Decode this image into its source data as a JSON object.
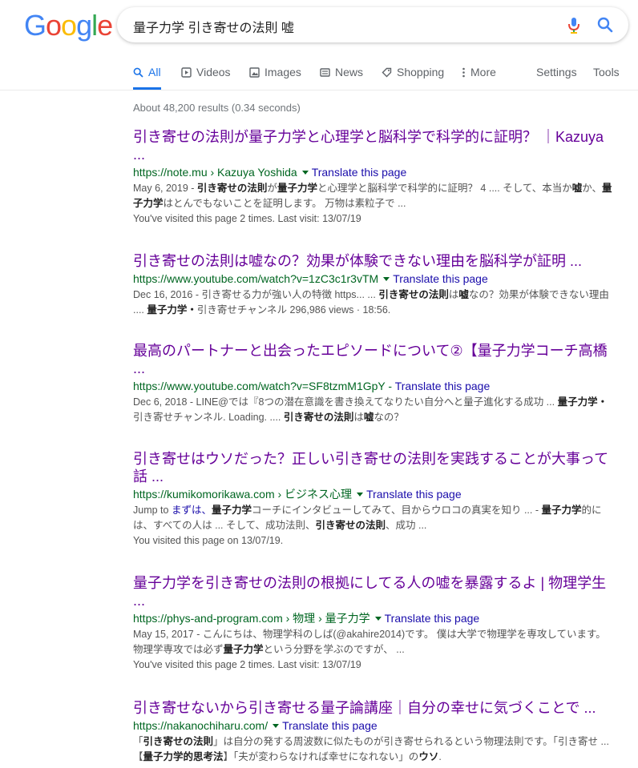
{
  "logo": {
    "letters": [
      "G",
      "o",
      "o",
      "g",
      "l",
      "e"
    ],
    "colors": [
      "#4285F4",
      "#EA4335",
      "#FBBC05",
      "#4285F4",
      "#34A853",
      "#EA4335"
    ]
  },
  "search": {
    "query": "量子力学 引き寄せの法則 嘘"
  },
  "tabs": [
    {
      "label": "All",
      "icon": "search-icon"
    },
    {
      "label": "Videos",
      "icon": "video-icon"
    },
    {
      "label": "Images",
      "icon": "image-icon"
    },
    {
      "label": "News",
      "icon": "news-icon"
    },
    {
      "label": "Shopping",
      "icon": "tag-icon"
    },
    {
      "label": "More",
      "icon": "more-vert-icon"
    },
    {
      "label": "Settings"
    },
    {
      "label": "Tools"
    }
  ],
  "stats": "About 48,200 results (0.34 seconds)",
  "results": [
    {
      "title": "引き寄せの法則が量子力学と心理学と脳科学で科学的に証明？ ｜Kazuya ...",
      "url": "https://note.mu › Kazuya Yoshida",
      "translate": "Translate this page",
      "snippet": [
        {
          "t": "May 6, 2019 - "
        },
        {
          "t": "引き寄せの法則",
          "b": true
        },
        {
          "t": "が"
        },
        {
          "t": "量子力学",
          "b": true
        },
        {
          "t": "と心理学と脳科学で科学的に証明？ 4 .... そして、本当か"
        },
        {
          "t": "嘘",
          "b": true
        },
        {
          "t": "か、"
        },
        {
          "t": "量子力学",
          "b": true
        },
        {
          "t": "はとんでもないことを証明します。 万物は素粒子で ..."
        }
      ],
      "visit": "You've visited this page 2 times. Last visit: 13/07/19"
    },
    {
      "title": "引き寄せの法則は嘘なの？効果が体験できない理由を脳科学が証明 ...",
      "url": "https://www.youtube.com/watch?v=1zC3c1r3vTM",
      "translate": "Translate this page",
      "snippet": [
        {
          "t": "Dec 16, 2016 - 引き寄せる力が強い人の特徴 https... ... "
        },
        {
          "t": "引き寄せの法則",
          "b": true
        },
        {
          "t": "は"
        },
        {
          "t": "嘘",
          "b": true
        },
        {
          "t": "なの？効果が体験できない"
        },
        {
          "t": "理由 .... "
        },
        {
          "t": "量子力学・",
          "b": true
        },
        {
          "t": "引き寄せチャンネル 296,986 views · 18:56."
        }
      ],
      "visit": ""
    },
    {
      "title": "最高のパートナーと出会ったエピソードについて②【量子力学コーチ高橋 ...",
      "url": "https://www.youtube.com/watch?v=SF8tzmM1GpY",
      "translate": "Translate this page",
      "snippet": [
        {
          "t": "Dec 6, 2018 - LINE@では『8つの潜在意識を書き換えてなりたい自分へと量子進化する成功 ... "
        },
        {
          "t": "量子力",
          "b": true
        },
        {
          "t": "学・",
          "b": true
        },
        {
          "t": "引き寄せチャンネル. Loading. .... "
        },
        {
          "t": "引き寄せの法則",
          "b": true
        },
        {
          "t": "は"
        },
        {
          "t": "嘘",
          "b": true
        },
        {
          "t": "なの？"
        }
      ],
      "visit": ""
    },
    {
      "title": "引き寄せはウソだった？正しい引き寄せの法則を実践することが大事って話 ...",
      "url": "https://kumikomorikawa.com › ビジネス心理",
      "translate": "Translate this page",
      "snippet": [
        {
          "t": "Jump to "
        },
        {
          "t": "まずは、"
        },
        {
          "t": "量子力学",
          "b": true
        },
        {
          "t": "コーチにインタビューしてみて、目からウロコの真実を知り ... - "
        },
        {
          "t": "量子力学",
          "b": true
        },
        {
          "t": "的"
        },
        {
          "t": "には、すべての人は ... そして、成功法則、"
        },
        {
          "t": "引き寄せの法則",
          "b": true
        },
        {
          "t": "、成功 ..."
        }
      ],
      "visit": "You visited this page on 13/07/19."
    },
    {
      "title": "量子力学を引き寄せの法則の根拠にしてる人の嘘を暴露するよ | 物理学生 ...",
      "url": "https://phys-and-program.com › 物理 › 量子力学",
      "translate": "Translate this page",
      "snippet": [
        {
          "t": "May 15, 2017 - こんにちは、物理学科のしば(@akahire2014)です。 僕は大学で物理学を専攻していま"
        },
        {
          "t": "す。 物理学専攻では必ず"
        },
        {
          "t": "量子力学",
          "b": true
        },
        {
          "t": "という分野を学ぶのですが、 ..."
        }
      ],
      "visit": "You've visited this page 2 times. Last visit: 13/07/19"
    },
    {
      "title": "引き寄せないから引き寄せる量子論講座｜自分の幸せに気づくことで ...",
      "url": "https://nakanochiharu.com/",
      "translate": "Translate this page",
      "snippet": [
        {
          "t": "「"
        },
        {
          "t": "引き寄せの法則",
          "b": true
        },
        {
          "t": "」は自分の発する周波数に似たものが引き寄せられるという物理法則です。「引き寄せ"
        },
        {
          "t": " ... 【"
        },
        {
          "t": "量子力学",
          "b": true
        },
        {
          "t": "的思考法",
          "b": true
        },
        {
          "t": "】「夫が変わらなければ幸せになれない」の"
        },
        {
          "t": "ウソ",
          "b": true
        },
        {
          "t": "."
        }
      ],
      "visit": ""
    }
  ]
}
